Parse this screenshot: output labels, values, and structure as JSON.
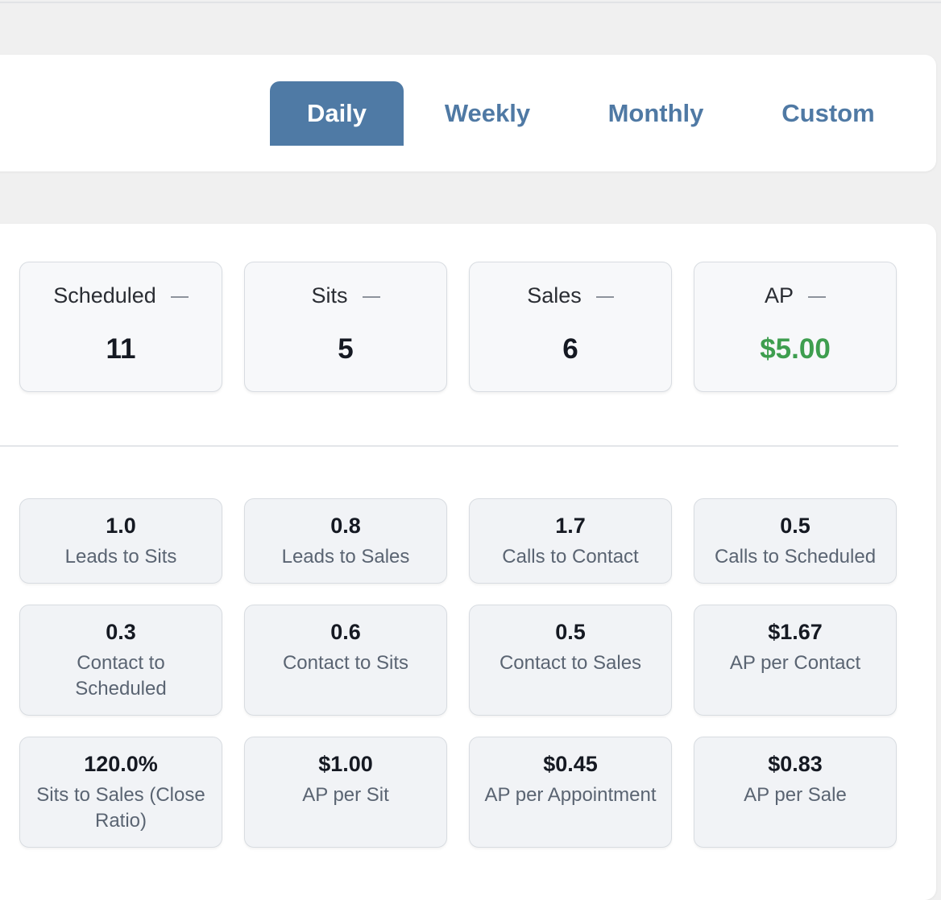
{
  "tabs": {
    "daily": "Daily",
    "weekly": "Weekly",
    "monthly": "Monthly",
    "custom": "Custom",
    "active": "Daily"
  },
  "stats": [
    {
      "label": "Scheduled",
      "value": "11",
      "icon": "minus-icon"
    },
    {
      "label": "Sits",
      "value": "5",
      "icon": "minus-icon"
    },
    {
      "label": "Sales",
      "value": "6",
      "icon": "minus-icon"
    },
    {
      "label": "AP",
      "value": "$5.00",
      "icon": "minus-icon",
      "value_color": "#3e9e4f"
    }
  ],
  "metrics": [
    {
      "value": "1.0",
      "label": "Leads to Sits"
    },
    {
      "value": "0.8",
      "label": "Leads to Sales"
    },
    {
      "value": "1.7",
      "label": "Calls to Contact"
    },
    {
      "value": "0.5",
      "label": "Calls to Scheduled"
    },
    {
      "value": "0.3",
      "label": "Contact to Scheduled"
    },
    {
      "value": "0.6",
      "label": "Contact to Sits"
    },
    {
      "value": "0.5",
      "label": "Contact to Sales"
    },
    {
      "value": "$1.67",
      "label": "AP per Contact"
    },
    {
      "value": "120.0%",
      "label": "Sits to Sales (Close Ratio)"
    },
    {
      "value": "$1.00",
      "label": "AP per Sit"
    },
    {
      "value": "$0.45",
      "label": "AP per Appointment"
    },
    {
      "value": "$0.83",
      "label": "AP per Sale"
    }
  ],
  "colors": {
    "accent": "#4f7aa5",
    "positive": "#3e9e4f",
    "background": "#f0f0f0",
    "card": "#ffffff"
  }
}
